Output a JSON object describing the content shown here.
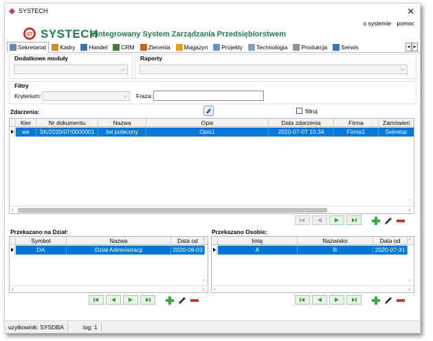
{
  "window": {
    "title": "SYSTECH"
  },
  "toplinks": {
    "about": "o systemie",
    "help": "pomoc"
  },
  "header": {
    "brand": "SYSTECH",
    "tagline": "Zintegrowany System Zarządzania Przedsiębiorstwem",
    "logo_text": "ST"
  },
  "tabs": [
    {
      "label": "Sekretariat",
      "icon": "sekretariat-icon",
      "color": "#6d87a8"
    },
    {
      "label": "Kadry",
      "icon": "kadry-icon",
      "color": "#d08a30"
    },
    {
      "label": "Handel",
      "icon": "handel-icon",
      "color": "#3a6fb0"
    },
    {
      "label": "CRM",
      "icon": "crm-icon",
      "color": "#4a7a3a"
    },
    {
      "label": "Zlecenia",
      "icon": "zlecenia-icon",
      "color": "#d06020"
    },
    {
      "label": "Magazyn",
      "icon": "magazyn-icon",
      "color": "#e0a020"
    },
    {
      "label": "Projekty",
      "icon": "projekty-icon",
      "color": "#7090c0"
    },
    {
      "label": "Technologia",
      "icon": "technologia-icon",
      "color": "#8aa0b8"
    },
    {
      "label": "Produkcja",
      "icon": "produkcja-icon",
      "color": "#9090a0"
    },
    {
      "label": "Serwis",
      "icon": "serwis-icon",
      "color": "#4070b0"
    }
  ],
  "modules": {
    "label": "Dodatkowe moduły",
    "value": ""
  },
  "reports": {
    "label": "Raporty",
    "value": ""
  },
  "filters": {
    "label": "Filtry",
    "criterion_label": "Kryterium:",
    "criterion_value": "",
    "phrase_label": "Fraza:",
    "phrase_value": ""
  },
  "events": {
    "label": "Zdarzenia:",
    "filter_label": "filtruj",
    "columns": [
      "Kier",
      "Nr dokumentu",
      "Nazwa",
      "Opis",
      "Data zdarzenia",
      "Firma",
      "Zamówien"
    ],
    "rows": [
      [
        "we",
        "SK/2020/07/0000001",
        "list polecony",
        "Opis1",
        "2020-07-07 10:34",
        "Firma1",
        "Sekretar"
      ]
    ]
  },
  "dept": {
    "label": "Przekazano na Dział:",
    "columns": [
      "Symbol",
      "Nazwa",
      "Data od"
    ],
    "rows": [
      [
        "DA",
        "Dział Administracji",
        "2020-08-03"
      ]
    ]
  },
  "person": {
    "label": "Przekazano Osobie:",
    "columns": [
      "Imię",
      "Nazwisko",
      "Data od"
    ],
    "rows": [
      [
        "A",
        "B",
        "2020-07-31"
      ]
    ]
  },
  "status": {
    "user_label": "uzytkownik:",
    "user": "SYSDBA",
    "log_label": "log:",
    "log": "1"
  }
}
